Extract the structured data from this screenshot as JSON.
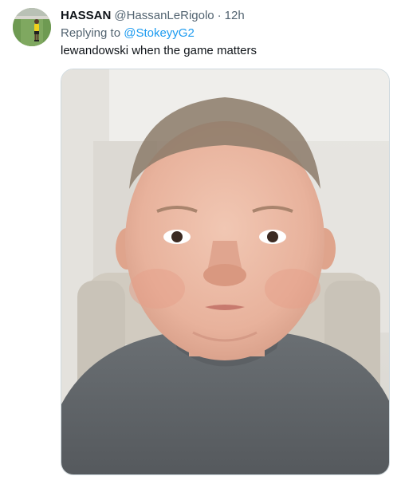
{
  "tweet": {
    "display_name": "HASSAN",
    "handle": "@HassanLeRigolo",
    "separator": "·",
    "timestamp": "12h",
    "reply_prefix": "Replying to ",
    "reply_to": "@StokeyyG2",
    "text": "lewandowski when the game matters",
    "avatar_icon": "profile-photo-footballer",
    "media_icon": "photo-child-face-close-up"
  },
  "colors": {
    "link": "#1d9bf0",
    "secondary_text": "#536471",
    "primary_text": "#0f1419"
  }
}
